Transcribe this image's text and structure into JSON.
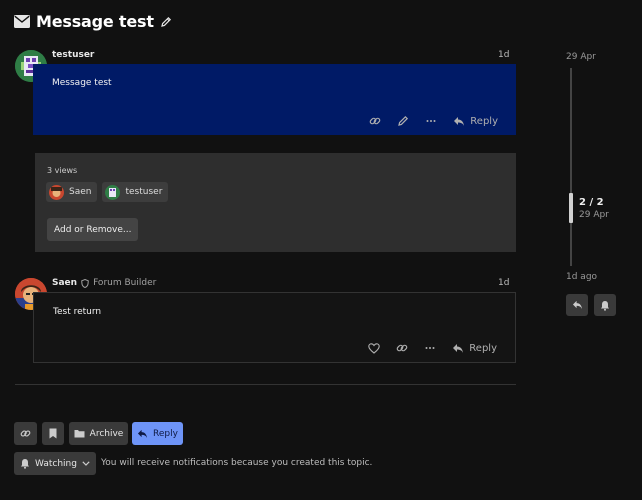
{
  "topic": {
    "title": "Message test"
  },
  "posts": [
    {
      "username": "testuser",
      "date": "1d",
      "body": "Message test",
      "reply_label": "Reply"
    },
    {
      "username": "Saen",
      "user_title": "Forum Builder",
      "date": "1d",
      "body": "Test return",
      "reply_label": "Reply"
    }
  ],
  "pm_panel": {
    "views": "3 views",
    "participants": [
      "Saen",
      "testuser"
    ],
    "add_remove_label": "Add or Remove..."
  },
  "timeline": {
    "start_date": "29 Apr",
    "position": "2 / 2",
    "position_date": "29 Apr",
    "end_label": "1d ago"
  },
  "footer": {
    "archive_label": "Archive",
    "reply_label": "Reply",
    "watching_label": "Watching",
    "notification_text": "You will receive notifications because you created this topic."
  },
  "colors": {
    "background": "#111111",
    "post_highlight": "#001a66",
    "primary_button": "#6e94f7"
  }
}
